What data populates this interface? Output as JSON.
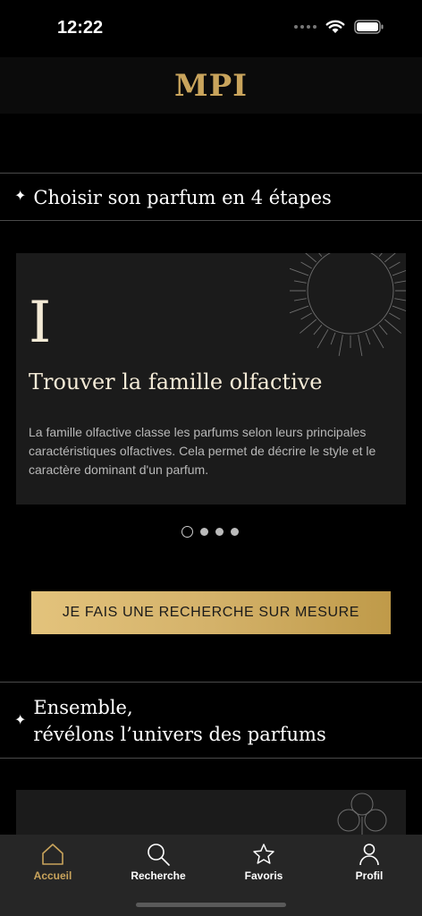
{
  "status": {
    "time": "12:22"
  },
  "header": {
    "logo": "MPI"
  },
  "section1": {
    "title": "Choisir son parfum en 4 étapes"
  },
  "card": {
    "numeral": "I",
    "title": "Trouver la famille olfactive",
    "description": "La famille olfactive classe les parfums selon leurs principales caractéristiques olfactives. Cela permet de décrire le style et le caractère dominant d'un parfum."
  },
  "pager": {
    "count": 4,
    "active": 0
  },
  "cta": {
    "label": "JE FAIS UNE RECHERCHE SUR MESURE"
  },
  "section2": {
    "line1": "Ensemble,",
    "line2": "révélons l’univers des parfums"
  },
  "tabs": [
    {
      "label": "Accueil",
      "icon": "home-icon",
      "active": true
    },
    {
      "label": "Recherche",
      "icon": "search-icon",
      "active": false
    },
    {
      "label": "Favoris",
      "icon": "star-icon",
      "active": false
    },
    {
      "label": "Profil",
      "icon": "profile-icon",
      "active": false
    }
  ],
  "colors": {
    "gold": "#c9a45c",
    "card": "#1b1b1b",
    "tabbar": "#262626"
  }
}
